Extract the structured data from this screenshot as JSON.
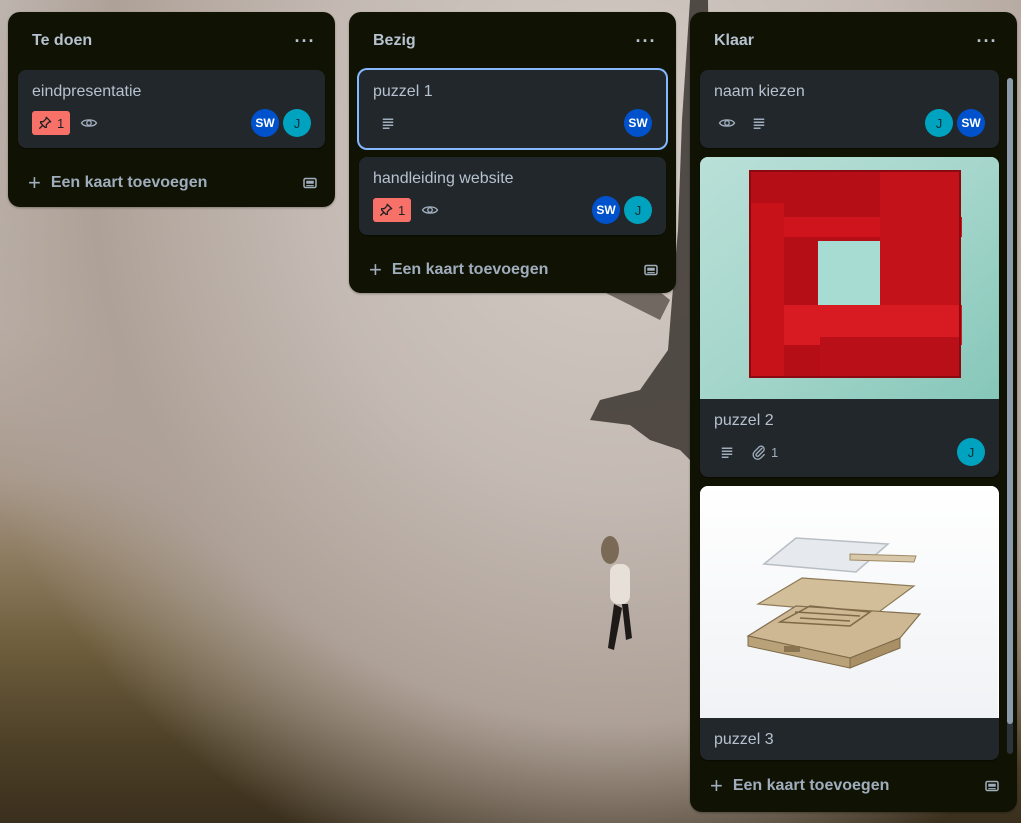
{
  "lists": [
    {
      "title": "Te doen",
      "menu_label": "···",
      "add_label": "Een kaart toevoegen",
      "cards": [
        {
          "title": "eindpresentatie",
          "due_count": "1",
          "members": [
            "SW",
            "J"
          ]
        }
      ]
    },
    {
      "title": "Bezig",
      "menu_label": "···",
      "add_label": "Een kaart toevoegen",
      "cards": [
        {
          "title": "puzzel 1",
          "members": [
            "SW"
          ]
        },
        {
          "title": "handleiding website",
          "due_count": "1",
          "members": [
            "SW",
            "J"
          ]
        }
      ]
    },
    {
      "title": "Klaar",
      "menu_label": "···",
      "add_label": "Een kaart toevoegen",
      "cards": [
        {
          "title": "naam kiezen",
          "members": [
            "J",
            "SW"
          ]
        },
        {
          "title": "puzzel 2",
          "attachment_count": "1",
          "members": [
            "J"
          ]
        },
        {
          "title": "puzzel 3"
        }
      ]
    }
  ],
  "colors": {
    "list_bg": "#101204",
    "card_bg": "#22272b",
    "due_badge": "#f87168",
    "avatar_sw": "#0052cc",
    "avatar_j": "#00a3bf",
    "selected_outline": "#85b8ff"
  },
  "icons": {
    "due": "pin-icon",
    "watch": "eye-icon",
    "description": "description-icon",
    "attachment": "paperclip-icon",
    "template": "card-template-icon",
    "add": "plus-icon",
    "menu": "more-icon"
  }
}
